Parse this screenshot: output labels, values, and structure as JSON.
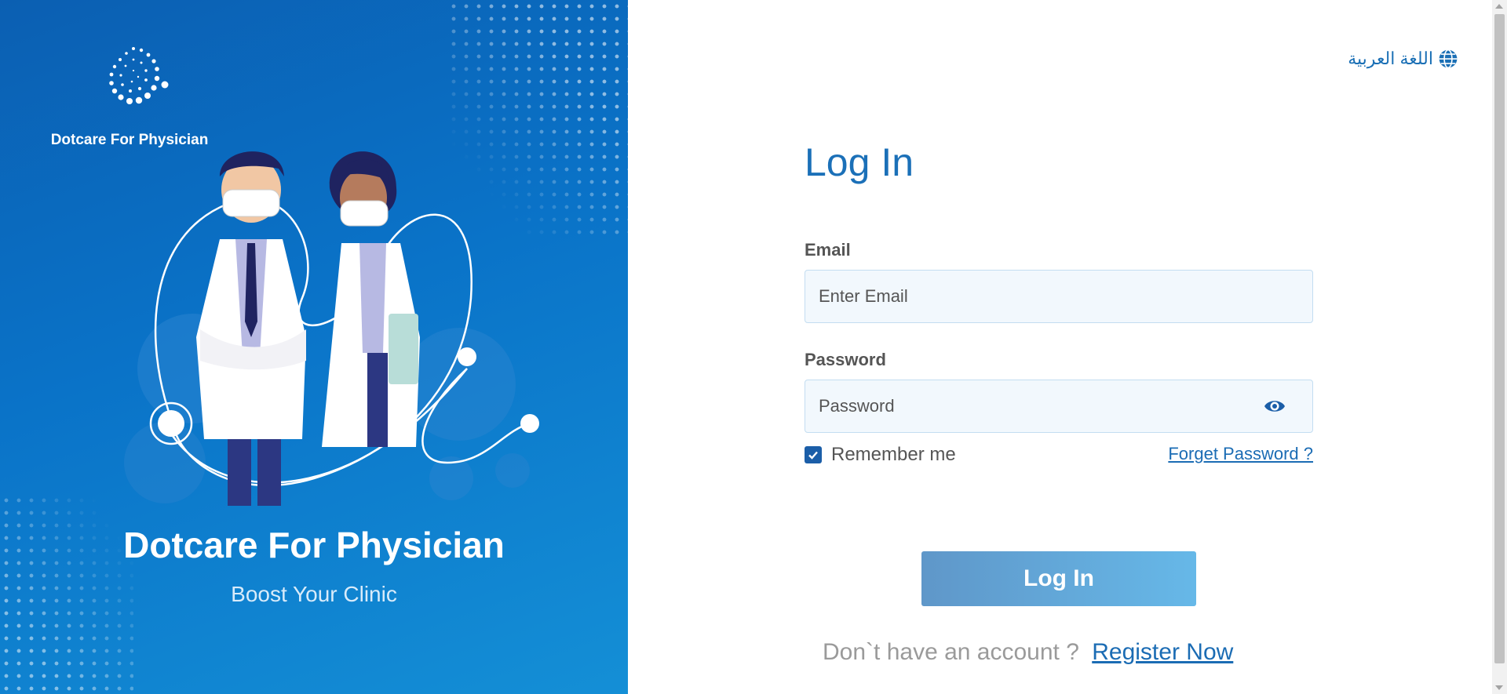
{
  "brand": {
    "logo_name": "Dotcare For Physician",
    "hero_title": "Dotcare For Physician",
    "hero_subtitle": "Boost Your Clinic"
  },
  "language_switch": {
    "label": "اللغة العربية",
    "icon": "globe-icon"
  },
  "login": {
    "title": "Log In",
    "email_label": "Email",
    "email_placeholder": "Enter Email",
    "email_value": "",
    "password_label": "Password",
    "password_placeholder": "Password",
    "password_value": "",
    "remember_label": "Remember me",
    "remember_checked": true,
    "forgot_label": "Forget Password ?",
    "submit_label": "Log In",
    "no_account_text": "Don`t have an account ?",
    "register_label": "Register Now"
  },
  "colors": {
    "primary": "#1b70b8",
    "panel_gradient_start": "#0b5fb2",
    "panel_gradient_end": "#148fd6",
    "button_start": "#5f97c9",
    "button_end": "#66b8e8",
    "input_bg": "#f2f8fd"
  }
}
